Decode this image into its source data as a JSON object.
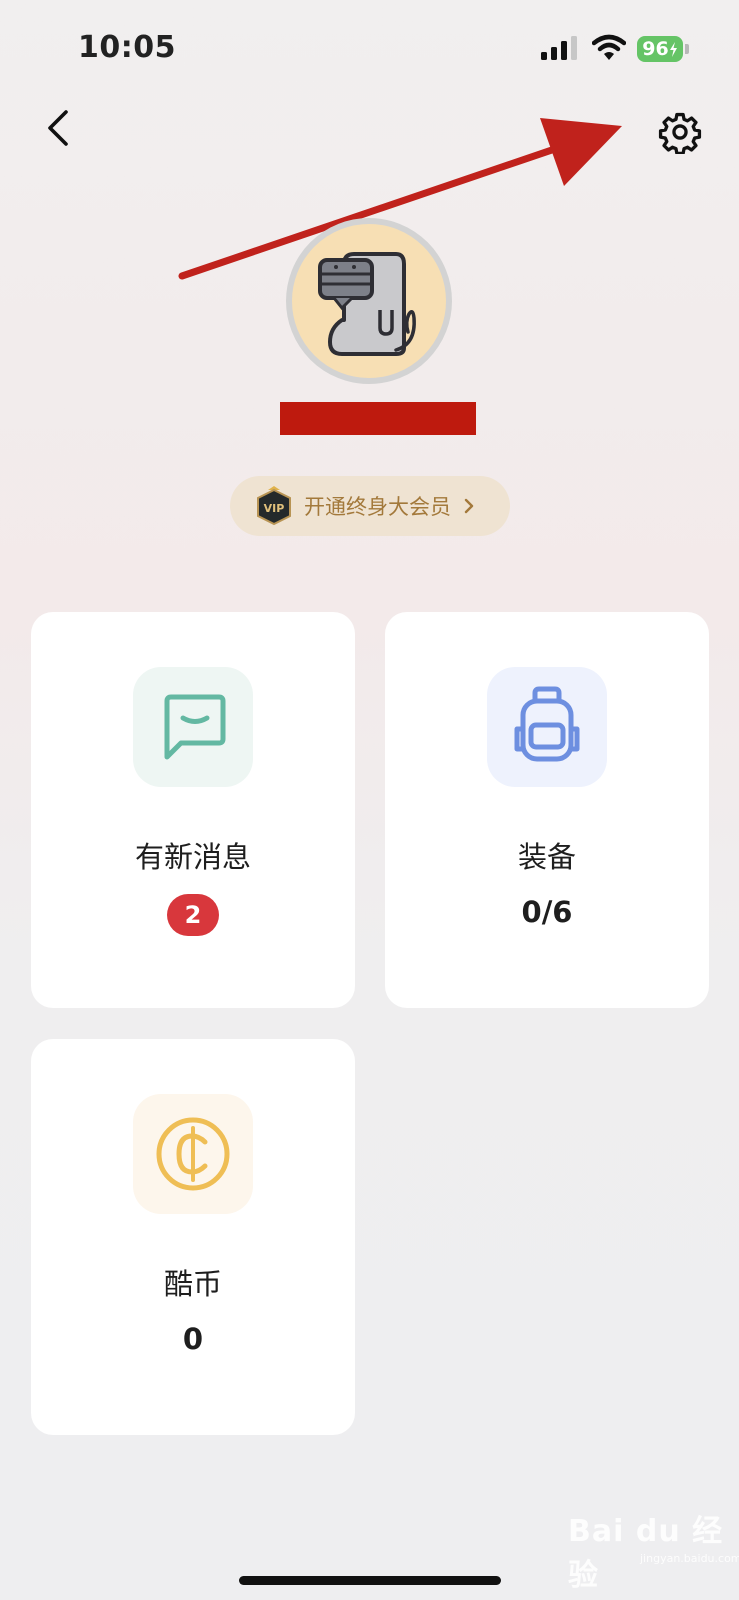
{
  "status_bar": {
    "time": "10:05",
    "battery": "96"
  },
  "profile": {
    "vip_label": "开通终身大会员"
  },
  "cards": [
    {
      "label": "有新消息",
      "badge": "2",
      "icon": "message-icon"
    },
    {
      "label": "装备",
      "value": "0/6",
      "icon": "backpack-icon"
    },
    {
      "label": "酷币",
      "value": "0",
      "icon": "coin-icon"
    }
  ],
  "colors": {
    "accent_red": "#be1a0e",
    "badge_red": "#d8373c",
    "vip_text": "#a3793b",
    "message_green": "#63b8a2",
    "backpack_blue": "#6d8fe0",
    "coin_yellow": "#efbe55"
  },
  "watermark": {
    "text": "Bai du 经验",
    "sub": "jingyan.baidu.com"
  }
}
